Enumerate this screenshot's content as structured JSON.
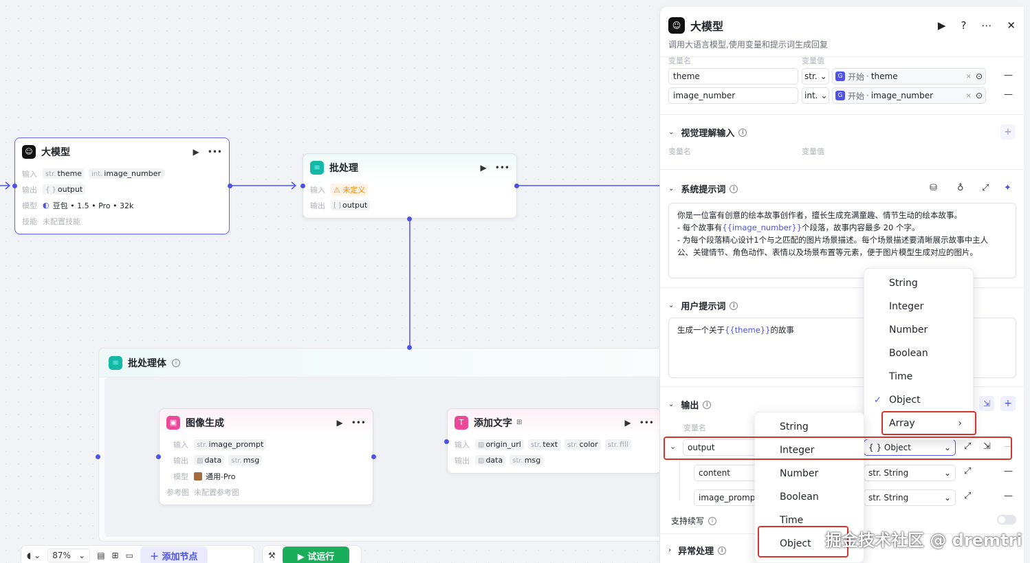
{
  "canvas": {
    "llm_node": {
      "title": "大模型",
      "input_label": "输入",
      "inputs": [
        {
          "type": "str.",
          "name": "theme"
        },
        {
          "type": "int.",
          "name": "image_number"
        }
      ],
      "output_label": "输出",
      "output": {
        "type": "{ }",
        "name": "output"
      },
      "model_label": "模型",
      "model": "豆包 • 1.5 • Pro • 32k",
      "skill_label": "技能",
      "skill": "未配置技能"
    },
    "batch_node": {
      "title": "批处理",
      "input_label": "输入",
      "input_value": "未定义",
      "output_label": "输出",
      "output": {
        "type": "[ ]",
        "name": "output"
      }
    },
    "batch_body": {
      "title": "批处理体"
    },
    "image_node": {
      "title": "图像生成",
      "input_label": "输入",
      "inputs": [
        {
          "type": "str.",
          "name": "image_prompt"
        }
      ],
      "output_label": "输出",
      "outputs": [
        {
          "type": "img",
          "name": "data"
        },
        {
          "type": "str.",
          "name": "msg"
        }
      ],
      "model_label": "模型",
      "model": "通用-Pro",
      "ref_label": "参考图",
      "ref": "未配置参考图"
    },
    "text_node": {
      "title": "添加文字",
      "input_label": "输入",
      "inputs": [
        {
          "type": "img",
          "name": "origin_url"
        },
        {
          "type": "str.",
          "name": "text"
        },
        {
          "type": "str.",
          "name": "color"
        },
        {
          "type": "str.",
          "name": "fill"
        }
      ],
      "output_label": "输出",
      "outputs": [
        {
          "type": "img",
          "name": "data"
        },
        {
          "type": "str.",
          "name": "msg"
        }
      ]
    },
    "toolbar": {
      "zoom": "87%",
      "add_node": "添加节点",
      "run": "试运行"
    }
  },
  "panel": {
    "title": "大模型",
    "description": "调用大语言模型,使用变量和提示词生成回复",
    "input_header_name": "变量名",
    "input_header_value": "变量值",
    "inputs": [
      {
        "name": "theme",
        "type": "str.",
        "ref_source": "开始",
        "ref_var": "theme"
      },
      {
        "name": "image_number",
        "type": "int.",
        "ref_source": "开始",
        "ref_var": "image_number"
      }
    ],
    "vision": {
      "title": "视觉理解输入",
      "col_name": "变量名",
      "col_value": "变量值"
    },
    "system_prompt": {
      "title": "系统提示词",
      "line1": "你是一位富有创意的绘本故事创作者，擅长生成充满童趣、情节生动的绘本故事。",
      "line2_pre": "- 每个故事有",
      "line2_var": "{{image_number}}",
      "line2_post": "个段落，故事内容最多 20 个字。",
      "line3": "- 为每个段落精心设计1个与之匹配的图片场景描述。每个场景描述要清晰展示故事中主人",
      "line4": "公、关键情节、角色动作、表情以及场景布置等元素，便于图片模型生成对应的图片。"
    },
    "user_prompt": {
      "title": "用户提示词",
      "pre": "生成一个关于",
      "var": "{{theme}}",
      "post": "的故事"
    },
    "output": {
      "title": "输出",
      "col_name": "变量名",
      "rows": [
        {
          "name": "output",
          "type": "{ } Object"
        },
        {
          "name": "content",
          "type": "str. String"
        },
        {
          "name": "image_prompt",
          "type": "str. String"
        }
      ],
      "continue_label": "支持续写"
    },
    "exception": {
      "title": "异常处理"
    }
  },
  "type_menu_upper": {
    "items": [
      "String",
      "Integer",
      "Number",
      "Boolean",
      "Time",
      "Object",
      "Array"
    ],
    "checked": "Object"
  },
  "type_menu_lower": {
    "items": [
      "String",
      "Integer",
      "Number",
      "Boolean",
      "Time",
      "Object"
    ]
  },
  "watermark": "掘金技术社区 @ dremtri",
  "colors": {
    "accent": "#4d53e8",
    "highlight": "#d9342b",
    "run": "#1aae5a"
  }
}
